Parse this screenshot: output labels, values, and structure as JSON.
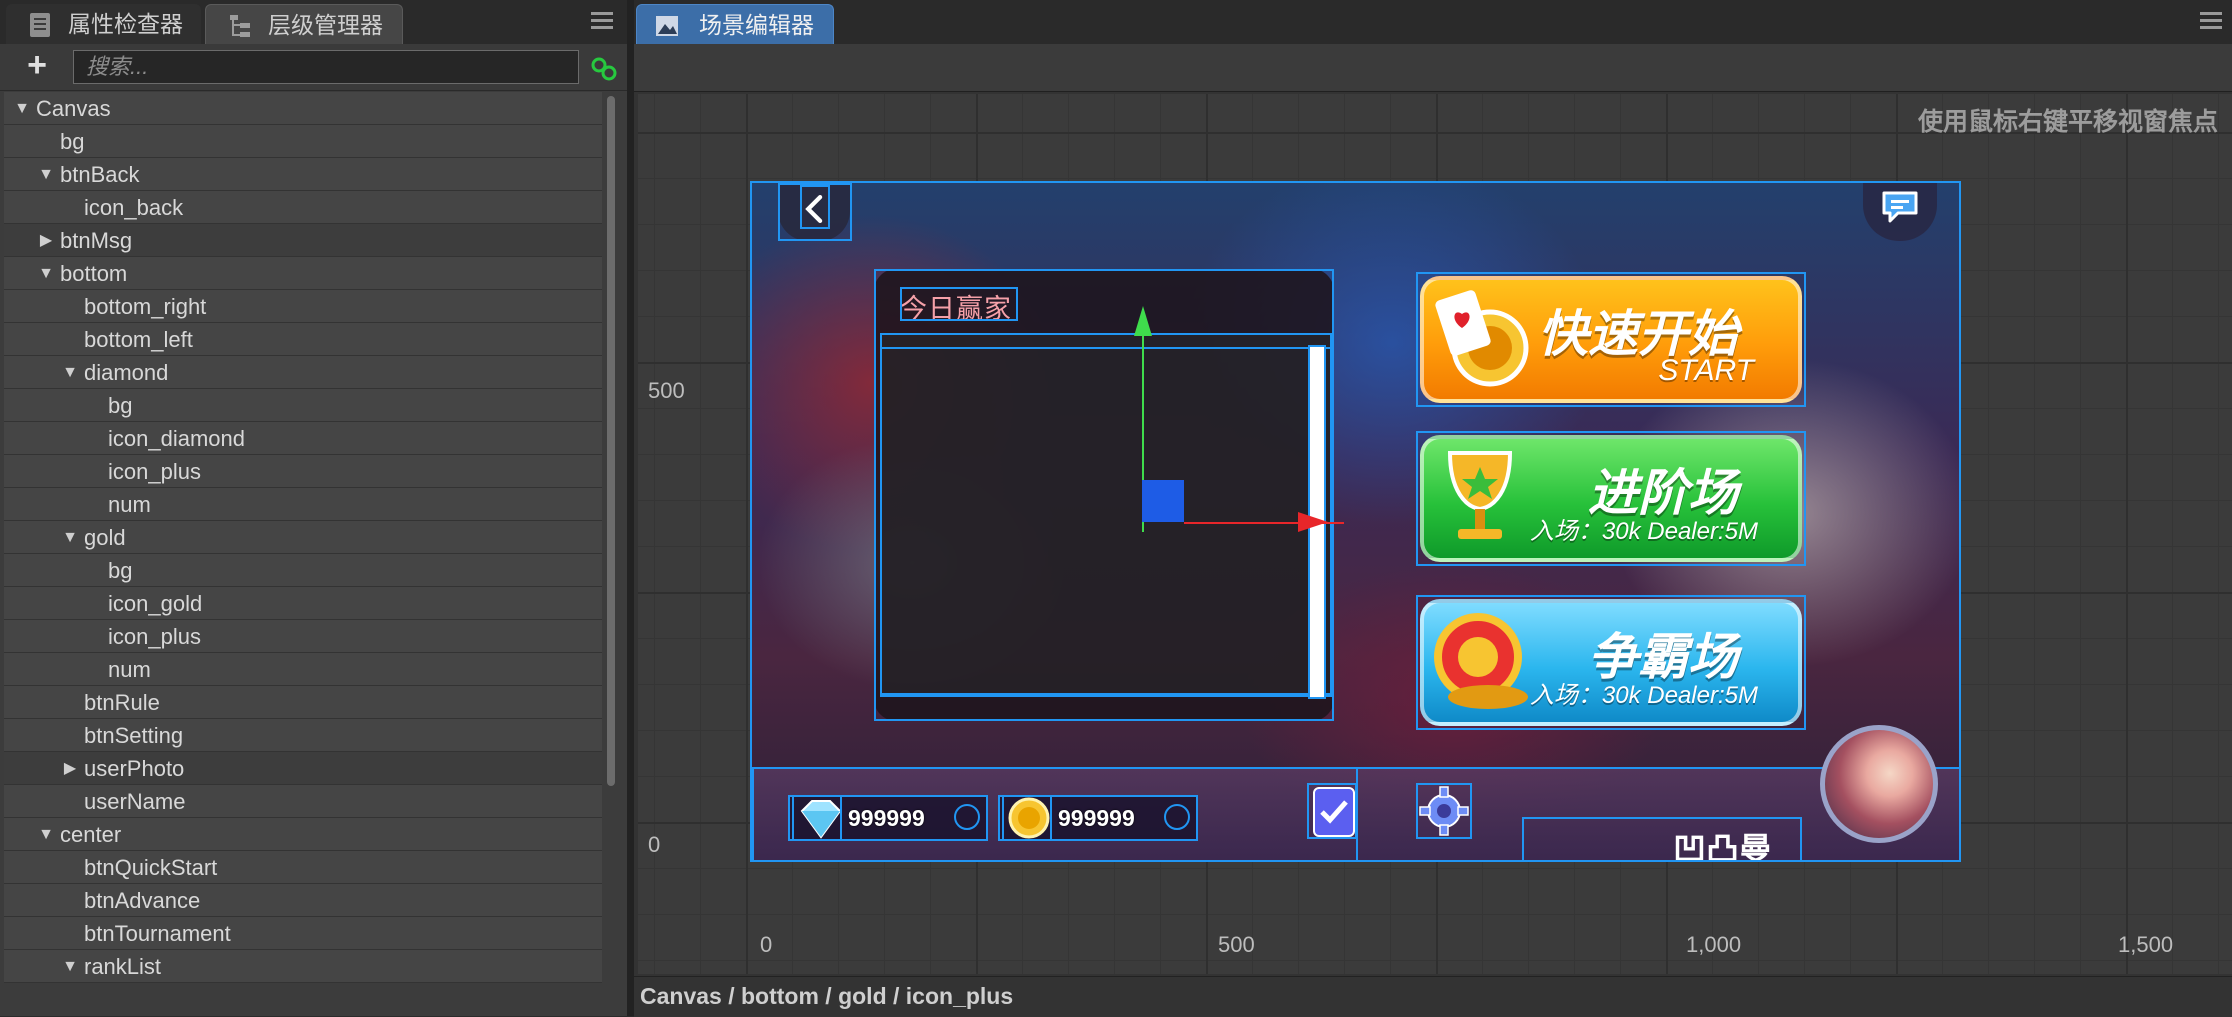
{
  "left_panel": {
    "tabs": [
      {
        "label": "属性检查器",
        "icon": "properties-icon"
      },
      {
        "label": "层级管理器",
        "icon": "hierarchy-icon"
      }
    ],
    "active_tab": "层级管理器",
    "toolbar": {
      "add_label": "+",
      "search_placeholder": "搜索...",
      "link_icon": "link-icon"
    },
    "tree": [
      {
        "label": "Canvas",
        "depth": 0,
        "state": "expanded"
      },
      {
        "label": "bg",
        "depth": 1,
        "state": "leaf"
      },
      {
        "label": "btnBack",
        "depth": 1,
        "state": "expanded"
      },
      {
        "label": "icon_back",
        "depth": 2,
        "state": "leaf"
      },
      {
        "label": "btnMsg",
        "depth": 1,
        "state": "collapsed"
      },
      {
        "label": "bottom",
        "depth": 1,
        "state": "expanded"
      },
      {
        "label": "bottom_right",
        "depth": 2,
        "state": "leaf"
      },
      {
        "label": "bottom_left",
        "depth": 2,
        "state": "leaf"
      },
      {
        "label": "diamond",
        "depth": 2,
        "state": "expanded"
      },
      {
        "label": "bg",
        "depth": 3,
        "state": "leaf"
      },
      {
        "label": "icon_diamond",
        "depth": 3,
        "state": "leaf"
      },
      {
        "label": "icon_plus",
        "depth": 3,
        "state": "leaf"
      },
      {
        "label": "num",
        "depth": 3,
        "state": "leaf"
      },
      {
        "label": "gold",
        "depth": 2,
        "state": "expanded"
      },
      {
        "label": "bg",
        "depth": 3,
        "state": "leaf"
      },
      {
        "label": "icon_gold",
        "depth": 3,
        "state": "leaf"
      },
      {
        "label": "icon_plus",
        "depth": 3,
        "state": "leaf"
      },
      {
        "label": "num",
        "depth": 3,
        "state": "leaf"
      },
      {
        "label": "btnRule",
        "depth": 2,
        "state": "leaf"
      },
      {
        "label": "btnSetting",
        "depth": 2,
        "state": "leaf"
      },
      {
        "label": "userPhoto",
        "depth": 2,
        "state": "collapsed"
      },
      {
        "label": "userName",
        "depth": 2,
        "state": "leaf"
      },
      {
        "label": "center",
        "depth": 1,
        "state": "expanded"
      },
      {
        "label": "btnQuickStart",
        "depth": 2,
        "state": "leaf"
      },
      {
        "label": "btnAdvance",
        "depth": 2,
        "state": "leaf"
      },
      {
        "label": "btnTournament",
        "depth": 2,
        "state": "leaf"
      },
      {
        "label": "rankList",
        "depth": 2,
        "state": "expanded"
      }
    ]
  },
  "scene_editor": {
    "tab": {
      "label": "场景编辑器",
      "icon": "scene-icon"
    },
    "hint": "使用鼠标右键平移视窗焦点",
    "axis": {
      "x_labels": [
        "0",
        "500",
        "1,000",
        "1,500"
      ],
      "y_labels": [
        "500",
        "0"
      ]
    },
    "breadcrumb": "Canvas / bottom / gold / icon_plus"
  },
  "game": {
    "rank_title": "今日赢家",
    "quick_start": {
      "title": "快速开始",
      "subtitle": "START"
    },
    "advance": {
      "title": "进阶场",
      "subtitle": "入场：30k    Dealer:5M"
    },
    "tournament": {
      "title": "争霸场",
      "subtitle": "入场：30k    Dealer:5M"
    },
    "diamond": {
      "value": "999999"
    },
    "gold": {
      "value": "999999"
    },
    "username": "凹凸曼"
  },
  "colors": {
    "selection": "#2196f3",
    "gizmo_x": "#e8262a",
    "gizmo_y": "#3fdc4c",
    "gizmo_center": "#1e5ce6"
  }
}
